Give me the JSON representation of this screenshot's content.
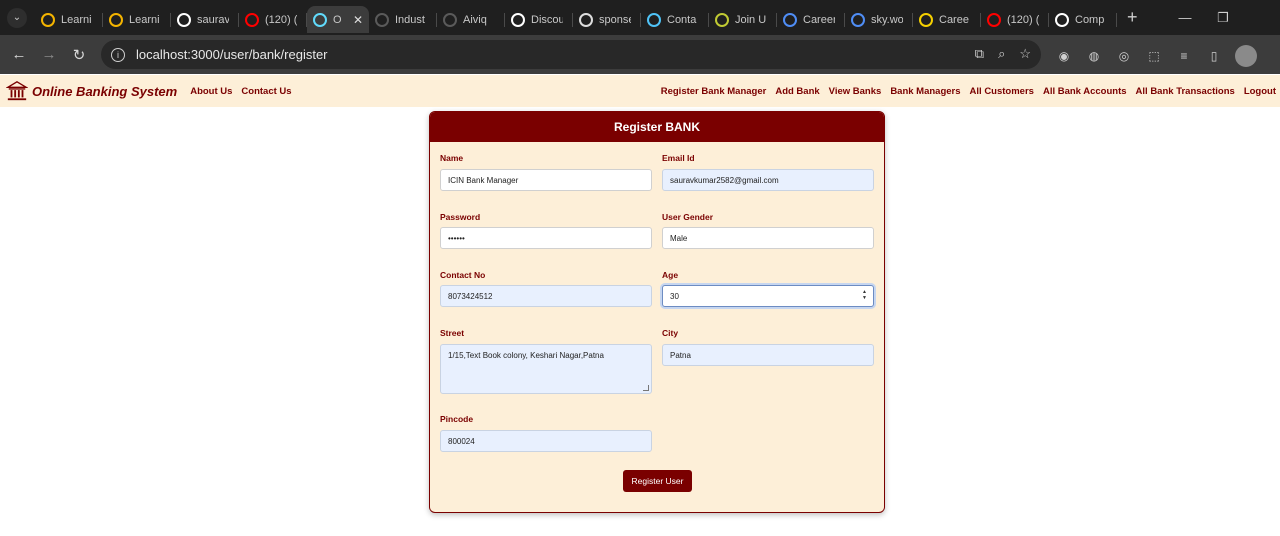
{
  "browser": {
    "tabs": [
      {
        "title": "Learni",
        "icon": "analytics-icon",
        "color": "#f4b400"
      },
      {
        "title": "Learni",
        "icon": "analytics-icon",
        "color": "#f4b400"
      },
      {
        "title": "saurav",
        "icon": "github-icon",
        "color": "#ffffff"
      },
      {
        "title": "(120) (",
        "icon": "youtube-icon",
        "color": "#ff0000"
      },
      {
        "title": "O",
        "icon": "react-icon",
        "color": "#61dafb",
        "active": true
      },
      {
        "title": "Indust",
        "icon": "b-icon",
        "color": "#5a5a5a"
      },
      {
        "title": "Aiviq",
        "icon": "b-icon",
        "color": "#5a5a5a"
      },
      {
        "title": "Discou",
        "icon": "discord-icon",
        "color": "#ffffff"
      },
      {
        "title": "sponse",
        "icon": "circle-icon",
        "color": "#dddddd"
      },
      {
        "title": "Conta",
        "icon": "hook-icon",
        "color": "#4fc3f7"
      },
      {
        "title": "Join U",
        "icon": "ring-icon",
        "color": "#c0ca33"
      },
      {
        "title": "Career",
        "icon": "career-icon",
        "color": "#4f8df5"
      },
      {
        "title": "sky.wo",
        "icon": "sky-icon",
        "color": "#4f8df5"
      },
      {
        "title": "Caree",
        "icon": "e-icon",
        "color": "#f5d000"
      },
      {
        "title": "(120) (",
        "icon": "youtube-icon",
        "color": "#ff0000"
      },
      {
        "title": "Comp",
        "icon": "github-icon",
        "color": "#ffffff"
      }
    ],
    "url": "localhost:3000/user/bank/register"
  },
  "appnav": {
    "brand": "Online Banking System",
    "left_links": [
      "About Us",
      "Contact Us"
    ],
    "right_links": [
      "Register Bank Manager",
      "Add Bank",
      "View Banks",
      "Bank Managers",
      "All Customers",
      "All Bank Accounts",
      "All Bank Transactions",
      "Logout"
    ]
  },
  "form": {
    "title": "Register BANK",
    "name_label": "Name",
    "name_value": "ICIN Bank Manager",
    "email_label": "Email Id",
    "email_value": "sauravkumar2582@gmail.com",
    "password_label": "Password",
    "password_value": "••••••",
    "gender_label": "User Gender",
    "gender_value": "Male",
    "contact_label": "Contact No",
    "contact_value": "8073424512",
    "age_label": "Age",
    "age_value": "30",
    "street_label": "Street",
    "street_value": "1/15,Text Book colony, Keshari Nagar,Patna",
    "city_label": "City",
    "city_value": "Patna",
    "pincode_label": "Pincode",
    "pincode_value": "800024",
    "submit_label": "Register User"
  },
  "colors": {
    "brand": "#7a0000",
    "nav_background": "#fdefd8",
    "autofill": "#e8f0fe"
  }
}
